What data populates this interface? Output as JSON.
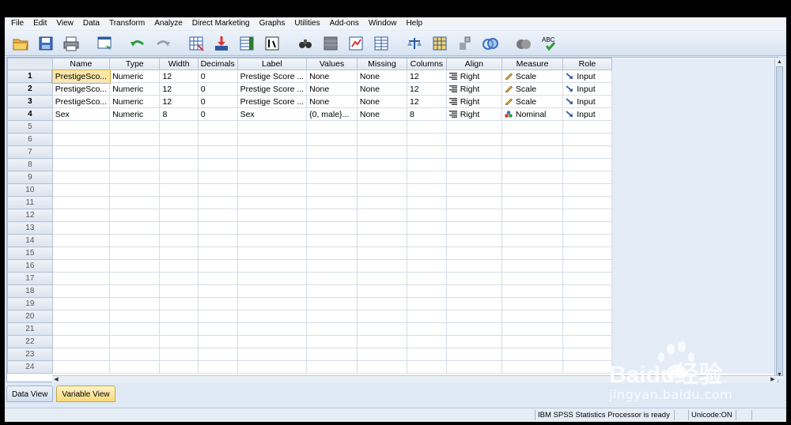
{
  "menu": [
    "File",
    "Edit",
    "View",
    "Data",
    "Transform",
    "Analyze",
    "Direct Marketing",
    "Graphs",
    "Utilities",
    "Add-ons",
    "Window",
    "Help"
  ],
  "toolbar_icons": [
    "open-folder-icon",
    "save-icon",
    "print-icon",
    "dialog-recall-icon",
    "undo-icon",
    "redo-icon",
    "goto-case-icon",
    "goto-variable-icon",
    "variables-icon",
    "run-descriptive-icon",
    "find-icon",
    "insert-cases-icon",
    "insert-variable-icon",
    "split-file-icon",
    "weight-cases-icon",
    "select-cases-icon",
    "value-labels-icon",
    "use-sets-icon",
    "show-all-icon",
    "spell-check-icon"
  ],
  "grid": {
    "columns": [
      "Name",
      "Type",
      "Width",
      "Decimals",
      "Label",
      "Values",
      "Missing",
      "Columns",
      "Align",
      "Measure",
      "Role"
    ],
    "rows": [
      {
        "num": "1",
        "name": "PrestigeSco...",
        "type": "Numeric",
        "width": "12",
        "decimals": "0",
        "label": "Prestige Score ...",
        "values": "None",
        "missing": "None",
        "columns": "12",
        "align": "Right",
        "measure": "Scale",
        "role": "Input"
      },
      {
        "num": "2",
        "name": "PrestigeSco...",
        "type": "Numeric",
        "width": "12",
        "decimals": "0",
        "label": "Prestige Score ...",
        "values": "None",
        "missing": "None",
        "columns": "12",
        "align": "Right",
        "measure": "Scale",
        "role": "Input"
      },
      {
        "num": "3",
        "name": "PrestigeSco...",
        "type": "Numeric",
        "width": "12",
        "decimals": "0",
        "label": "Prestige Score ...",
        "values": "None",
        "missing": "None",
        "columns": "12",
        "align": "Right",
        "measure": "Scale",
        "role": "Input"
      },
      {
        "num": "4",
        "name": "Sex",
        "type": "Numeric",
        "width": "8",
        "decimals": "0",
        "label": "Sex",
        "values": "{0, male}...",
        "missing": "None",
        "columns": "8",
        "align": "Right",
        "measure": "Nominal",
        "role": "Input"
      }
    ],
    "empty_rows": [
      "5",
      "6",
      "7",
      "8",
      "9",
      "10",
      "11",
      "12",
      "13",
      "14",
      "15",
      "16",
      "17",
      "18",
      "19",
      "20",
      "21",
      "22",
      "23",
      "24"
    ]
  },
  "tabs": [
    "Data View",
    "Variable View"
  ],
  "active_tab": "Variable View",
  "status": {
    "processor": "IBM SPSS Statistics Processor is ready",
    "unicode": "Unicode:ON"
  },
  "watermark": {
    "site": "jingyan.baidu.com",
    "brand": "Baidu经验"
  },
  "colors": {
    "selected_cell": "#fde8a9",
    "active_tab": "#f7d978",
    "app_bg": "#dfe9f5"
  }
}
